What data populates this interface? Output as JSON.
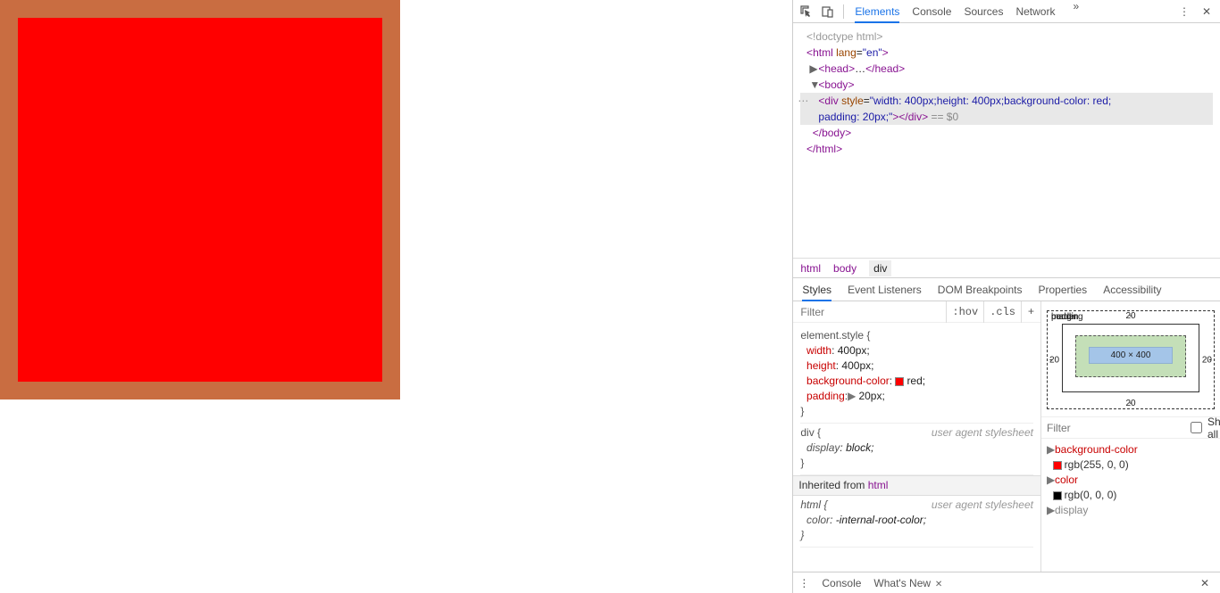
{
  "tabs": {
    "elements": "Elements",
    "console": "Console",
    "sources": "Sources",
    "network": "Network"
  },
  "dom": {
    "doctype": "<!doctype html>",
    "html_open": "html",
    "lang_attr": "lang",
    "lang_val": "\"en\"",
    "head": "head",
    "body": "body",
    "div": "div",
    "style_attr": "style",
    "style_val": "\"width: 400px;height: 400px;background-color: red; padding: 20px;\"",
    "eq": "== $0",
    "close_body": "body",
    "close_html": "html"
  },
  "crumbs": {
    "html": "html",
    "body": "body",
    "div": "div"
  },
  "subtabs": {
    "styles": "Styles",
    "ev": "Event Listeners",
    "dom": "DOM Breakpoints",
    "props": "Properties",
    "acc": "Accessibility"
  },
  "filter": {
    "placeholder": "Filter",
    "hov": ":hov",
    "cls": ".cls"
  },
  "rules": {
    "element_style": "element.style {",
    "width": "width",
    "width_v": "400px;",
    "height": "height",
    "height_v": "400px;",
    "bg": "background-color",
    "bg_v": "red;",
    "pad": "padding",
    "pad_v": "20px;",
    "close": "}",
    "div_sel": "div {",
    "uas": "user agent stylesheet",
    "display": "display",
    "display_v": "block;",
    "inh": "Inherited from ",
    "inh_link": "html",
    "html_sel": "html {",
    "color": "color",
    "color_v": "-internal-root-color;"
  },
  "box": {
    "margin": "margin",
    "border": "border",
    "padding": "padding",
    "pad_t": "20",
    "pad_b": "20",
    "pad_l": "20",
    "pad_r": "20",
    "content": "400 × 400",
    "dash": "-"
  },
  "comp": {
    "filter": "Filter",
    "showall": "Show all",
    "bg": "background-color",
    "bg_v": "rgb(255, 0, 0)",
    "color": "color",
    "color_v": "rgb(0, 0, 0)",
    "display": "display"
  },
  "drawer": {
    "console": "Console",
    "whatsnew": "What's New"
  }
}
